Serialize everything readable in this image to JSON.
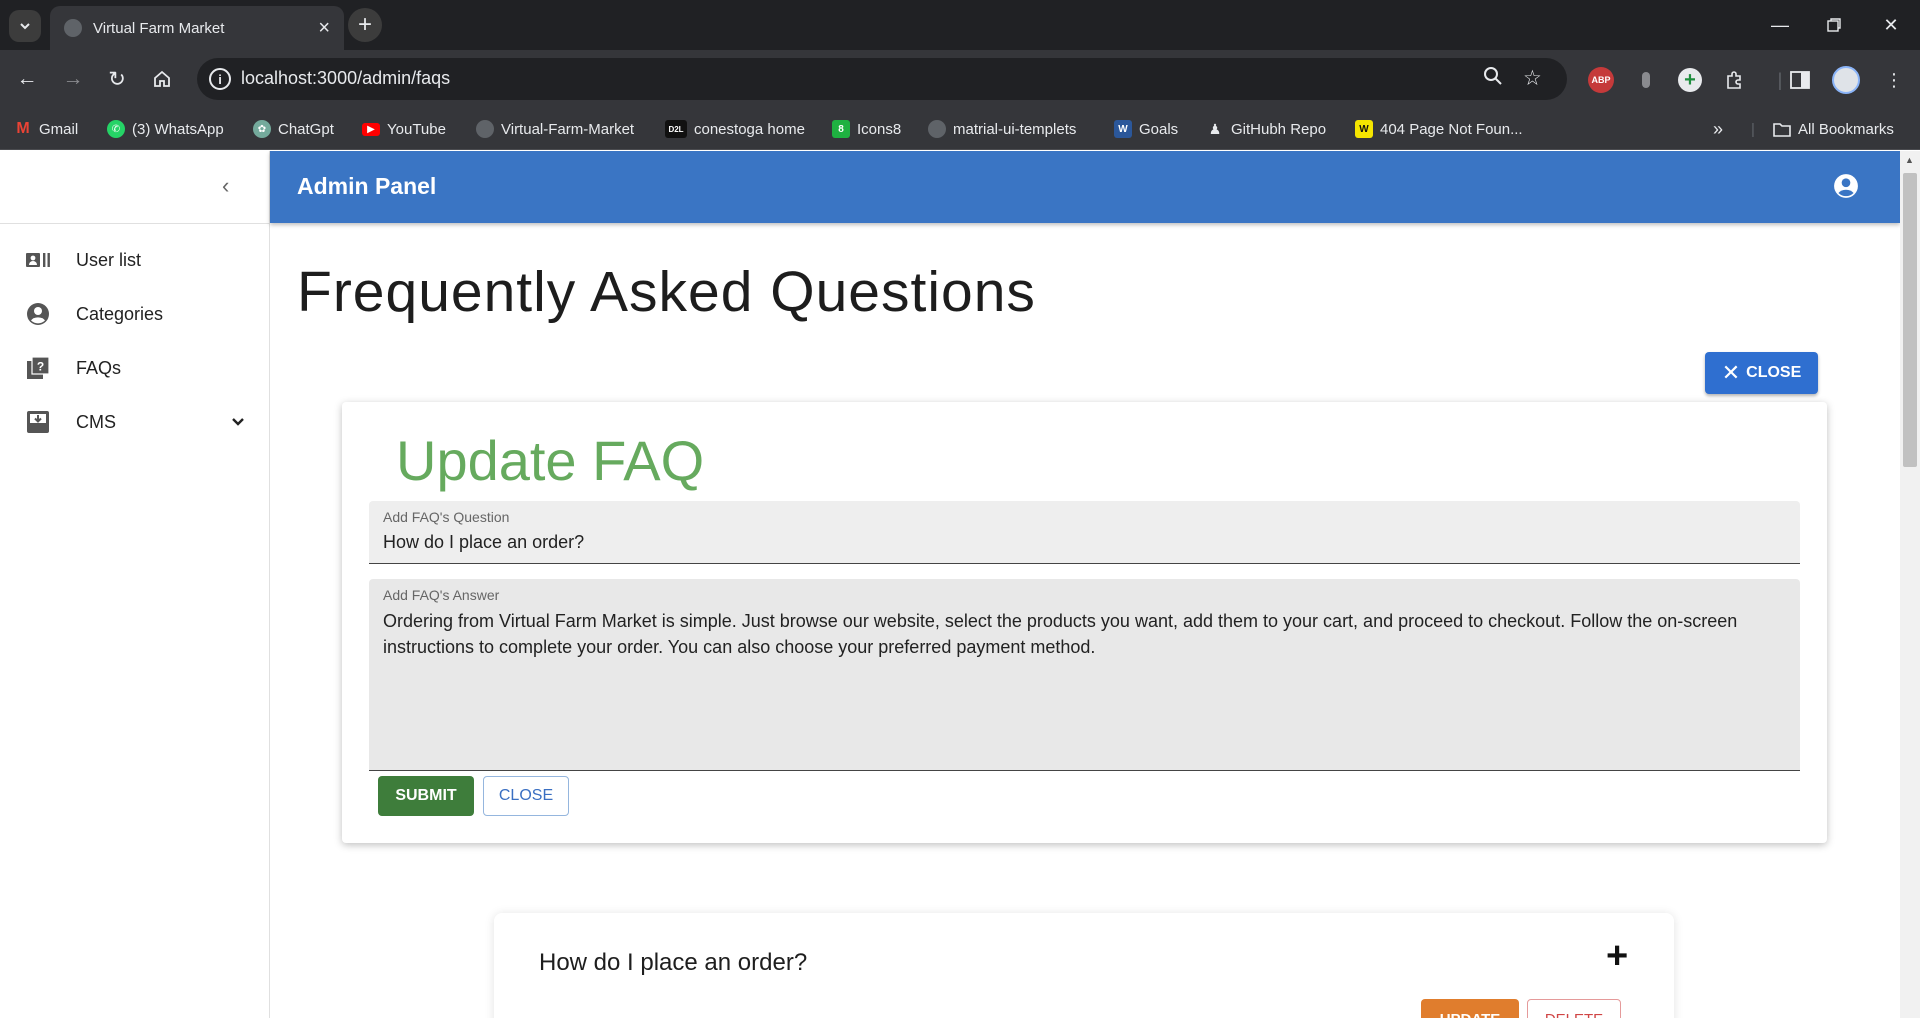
{
  "browser": {
    "tab_title": "Virtual Farm Market",
    "url": "localhost:3000/admin/faqs",
    "bookmarks": [
      {
        "label": "Gmail",
        "icon": "gmail-icon",
        "color": "#ea4335"
      },
      {
        "label": "(3) WhatsApp",
        "icon": "whatsapp-icon",
        "color": "#25d366"
      },
      {
        "label": "ChatGpt",
        "icon": "chatgpt-icon",
        "color": "#74aa9c"
      },
      {
        "label": "YouTube",
        "icon": "youtube-icon",
        "color": "#ff0000"
      },
      {
        "label": "Virtual-Farm-Market",
        "icon": "github-icon",
        "color": "#5f6368"
      },
      {
        "label": "conestoga home",
        "icon": "d2l-icon",
        "color": "#111111"
      },
      {
        "label": "Icons8",
        "icon": "icons8-icon",
        "color": "#1fb141"
      },
      {
        "label": "matrial-ui-templets",
        "icon": "github-icon",
        "color": "#5f6368"
      },
      {
        "label": "Goals",
        "icon": "word-icon",
        "color": "#2b579a"
      },
      {
        "label": "GitHubh Repo",
        "icon": "person-icon",
        "color": "#e8eaed"
      },
      {
        "label": "404 Page Not Foun...",
        "icon": "w-icon",
        "color": "#f5e500"
      }
    ],
    "all_bookmarks": "All Bookmarks"
  },
  "sidebar": {
    "items": [
      {
        "label": "User list",
        "icon": "user-list-icon"
      },
      {
        "label": "Categories",
        "icon": "account-circle-icon"
      },
      {
        "label": "FAQs",
        "icon": "faq-icon"
      },
      {
        "label": "CMS",
        "icon": "cms-icon"
      }
    ]
  },
  "appbar": {
    "title": "Admin Panel"
  },
  "main": {
    "heading": "Frequently Asked Questions",
    "close_top_label": "CLOSE",
    "form": {
      "title": "Update FAQ",
      "question_label": "Add FAQ's Question",
      "question_value": "How do I place an order?",
      "answer_label": "Add FAQ's Answer",
      "answer_value": "Ordering from Virtual Farm Market is simple. Just browse our website, select the products you want, add them to your cart, and proceed to checkout. Follow the on-screen instructions to complete your order. You can also choose your preferred payment method.",
      "submit_label": "SUBMIT",
      "close_label": "CLOSE"
    },
    "faq_item": {
      "question": "How do I place an order?",
      "update_label": "UPDATE",
      "delete_label": "DELETE"
    }
  },
  "colors": {
    "appbar": "#3a75c4",
    "form_title": "#66aa5e",
    "submit": "#3e7d3b",
    "update": "#e07d2d",
    "delete": "#d04545"
  }
}
